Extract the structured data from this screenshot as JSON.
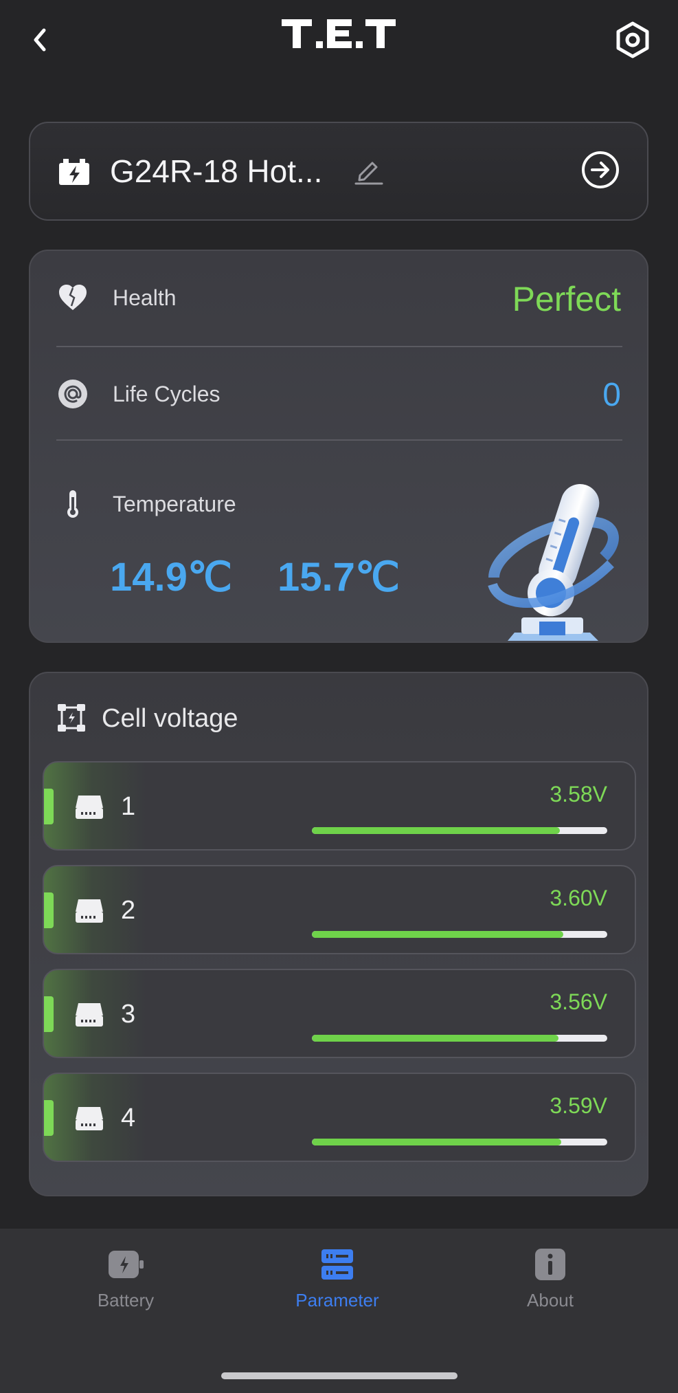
{
  "header": {
    "logo_text": "T.E.T",
    "back_icon": "chevron-left-icon",
    "settings_icon": "hexagon-gear-icon"
  },
  "device": {
    "name": "G24R-18 Hot...",
    "icon": "battery-bolt-icon",
    "edit_icon": "pencil-icon",
    "goto_icon": "arrow-right-circle-icon"
  },
  "stats": {
    "health": {
      "label": "Health",
      "value": "Perfect",
      "color": "#7ed957"
    },
    "life_cycles": {
      "label": "Life Cycles",
      "value": "0",
      "color": "#4aa8f0"
    },
    "temperature": {
      "label": "Temperature",
      "values": [
        "14.9℃",
        "15.7℃"
      ],
      "color": "#4aa8f0"
    }
  },
  "cells": {
    "title": "Cell voltage",
    "items": [
      {
        "label": "1",
        "voltage": "3.58V",
        "level": 0.84
      },
      {
        "label": "2",
        "voltage": "3.60V",
        "level": 0.85
      },
      {
        "label": "3",
        "voltage": "3.56V",
        "level": 0.835
      },
      {
        "label": "4",
        "voltage": "3.59V",
        "level": 0.845
      }
    ]
  },
  "nav": {
    "items": [
      {
        "label": "Battery",
        "active": false
      },
      {
        "label": "Parameter",
        "active": true
      },
      {
        "label": "About",
        "active": false
      }
    ],
    "active_color": "#3d7ef0",
    "inactive_color": "#8a8a90"
  }
}
